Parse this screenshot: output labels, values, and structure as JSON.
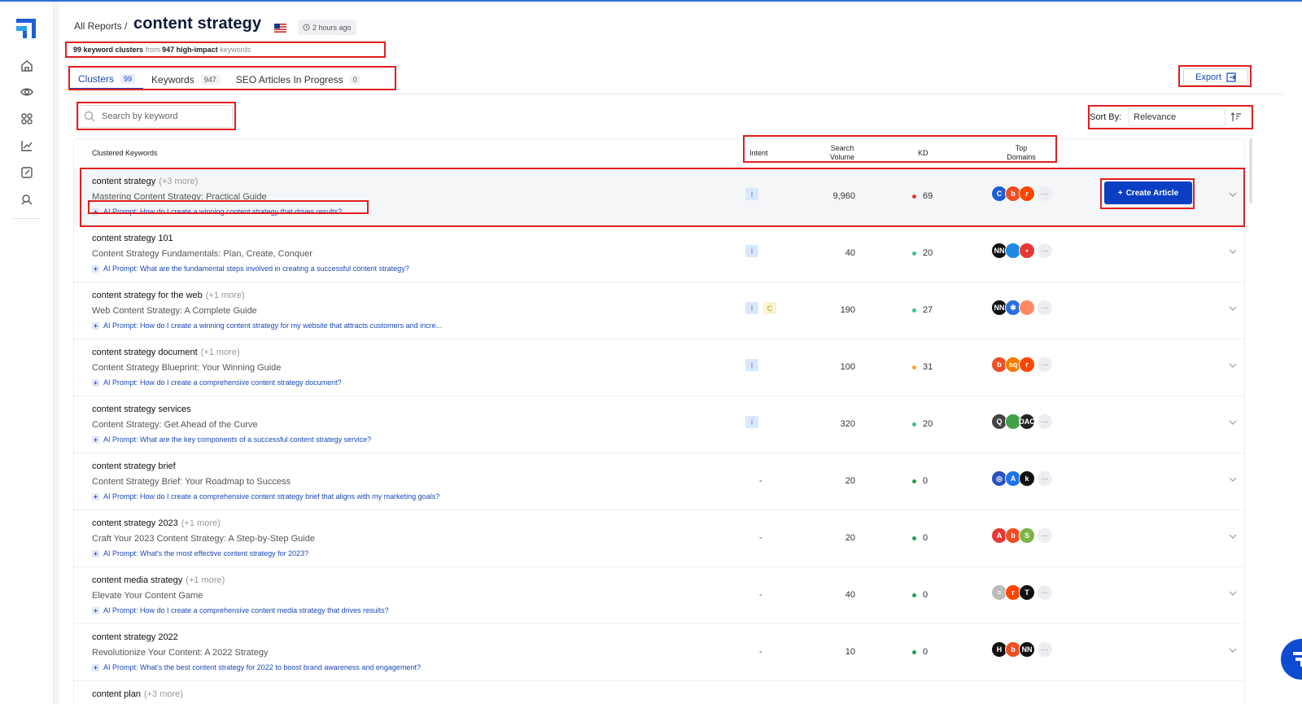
{
  "header": {
    "breadcrumb": "All Reports /",
    "title": "content strategy",
    "updated": "2 hours ago",
    "summary": {
      "clusters_count": "99 keyword clusters",
      "from_text": "from",
      "keywords_count": "947 high-impact",
      "keywords_suffix": "keywords"
    }
  },
  "tabs": [
    {
      "label": "Clusters",
      "count": "99"
    },
    {
      "label": "Keywords",
      "count": "947"
    },
    {
      "label": "SEO Articles In Progress",
      "count": "0"
    }
  ],
  "export_label": "Export",
  "search": {
    "placeholder": "Search by keyword"
  },
  "sort": {
    "label": "Sort By:",
    "value": "Relevance"
  },
  "columns": {
    "keywords": "Clustered Keywords",
    "intent": "Intent",
    "volume_1": "Search",
    "volume_2": "Volume",
    "kd": "KD",
    "domains_1": "Top",
    "domains_2": "Domains"
  },
  "create_article_label": "Create Article",
  "prompt_prefix": "AI Prompt:",
  "rows": [
    {
      "keyword": "content strategy",
      "more": "(+3 more)",
      "title": "Mastering Content Strategy: Practical Guide",
      "prompt": "AI Prompt: How do I create a winning content strategy that drives results?",
      "intent": [
        "I"
      ],
      "volume": "9,960",
      "kd": "69",
      "kd_color": "#e53935"
    },
    {
      "keyword": "content strategy 101",
      "more": "",
      "title": "Content Strategy Fundamentals: Plan, Create, Conquer",
      "prompt": "AI Prompt: What are the fundamental steps involved in creating a successful content strategy?",
      "intent": [
        "I"
      ],
      "volume": "40",
      "kd": "20",
      "kd_color": "#3cc28a"
    },
    {
      "keyword": "content strategy for the web",
      "more": "(+1 more)",
      "title": "Web Content Strategy: A Complete Guide",
      "prompt": "AI Prompt: How do I create a winning content strategy for my website that attracts customers and incre...",
      "intent": [
        "I",
        "C"
      ],
      "volume": "190",
      "kd": "27",
      "kd_color": "#3cc28a"
    },
    {
      "keyword": "content strategy document",
      "more": "(+1 more)",
      "title": "Content Strategy Blueprint: Your Winning Guide",
      "prompt": "AI Prompt: How do I create a comprehensive content strategy document?",
      "intent": [
        "I"
      ],
      "volume": "100",
      "kd": "31",
      "kd_color": "#f5a623"
    },
    {
      "keyword": "content strategy services",
      "more": "",
      "title": "Content Strategy: Get Ahead of the Curve",
      "prompt": "AI Prompt: What are the key components of a successful content strategy service?",
      "intent": [
        "I"
      ],
      "volume": "320",
      "kd": "20",
      "kd_color": "#3cc28a"
    },
    {
      "keyword": "content strategy brief",
      "more": "",
      "title": "Content Strategy Brief: Your Roadmap to Success",
      "prompt": "AI Prompt: How do I create a comprehensive content strategy brief that aligns with my marketing goals?",
      "intent": [],
      "volume": "20",
      "kd": "0",
      "kd_color": "#1e9e5a"
    },
    {
      "keyword": "content strategy 2023",
      "more": "(+1 more)",
      "title": "Craft Your 2023 Content Strategy: A Step-by-Step Guide",
      "prompt": "AI Prompt: What's the most effective content strategy for 2023?",
      "intent": [],
      "volume": "20",
      "kd": "0",
      "kd_color": "#1e9e5a"
    },
    {
      "keyword": "content media strategy",
      "more": "(+1 more)",
      "title": "Elevate Your Content Game",
      "prompt": "AI Prompt: How do I create a comprehensive content media strategy that drives results?",
      "intent": [],
      "volume": "40",
      "kd": "0",
      "kd_color": "#1e9e5a"
    },
    {
      "keyword": "content strategy 2022",
      "more": "",
      "title": "Revolutionize Your Content: A 2022 Strategy",
      "prompt": "AI Prompt: What's the best content strategy for 2022 to boost brand awareness and engagement?",
      "intent": [],
      "volume": "10",
      "kd": "0",
      "kd_color": "#1e9e5a"
    },
    {
      "keyword": "content plan",
      "more": "(+3 more)",
      "title": "",
      "prompt": "",
      "intent": [],
      "volume": "",
      "kd": "",
      "kd_color": "#1e9e5a"
    }
  ],
  "intent_empty": "-",
  "domain_more": "···",
  "domains": [
    [
      {
        "t": "C",
        "c": "#1f5fd6"
      },
      {
        "t": "b",
        "c": "#f04e23"
      },
      {
        "t": "r",
        "c": "#ff4500"
      }
    ],
    [
      {
        "t": "NN",
        "c": "#111"
      },
      {
        "t": "",
        "c": "#1e88e5"
      },
      {
        "t": "•",
        "c": "#e53935"
      }
    ],
    [
      {
        "t": "NN",
        "c": "#111"
      },
      {
        "t": "✱",
        "c": "#2b6de0"
      },
      {
        "t": "",
        "c": "#ff8a65"
      }
    ],
    [
      {
        "t": "b",
        "c": "#f04e23"
      },
      {
        "t": "sq",
        "c": "#f57c00"
      },
      {
        "t": "r",
        "c": "#ff4500"
      }
    ],
    [
      {
        "t": "Q",
        "c": "#444"
      },
      {
        "t": "",
        "c": "#43a047"
      },
      {
        "t": "DAC",
        "c": "#222"
      }
    ],
    [
      {
        "t": "◎",
        "c": "#2b4fbf"
      },
      {
        "t": "A",
        "c": "#1a73e8"
      },
      {
        "t": "k",
        "c": "#111"
      }
    ],
    [
      {
        "t": "A",
        "c": "#e53935"
      },
      {
        "t": "b",
        "c": "#f04e23"
      },
      {
        "t": "S",
        "c": "#7cb342"
      }
    ],
    [
      {
        "t": "≡",
        "c": "#bbb"
      },
      {
        "t": "r",
        "c": "#ff4500"
      },
      {
        "t": "T",
        "c": "#111"
      }
    ],
    [
      {
        "t": "H",
        "c": "#111"
      },
      {
        "t": "b",
        "c": "#f04e23"
      },
      {
        "t": "NN",
        "c": "#111"
      }
    ]
  ]
}
